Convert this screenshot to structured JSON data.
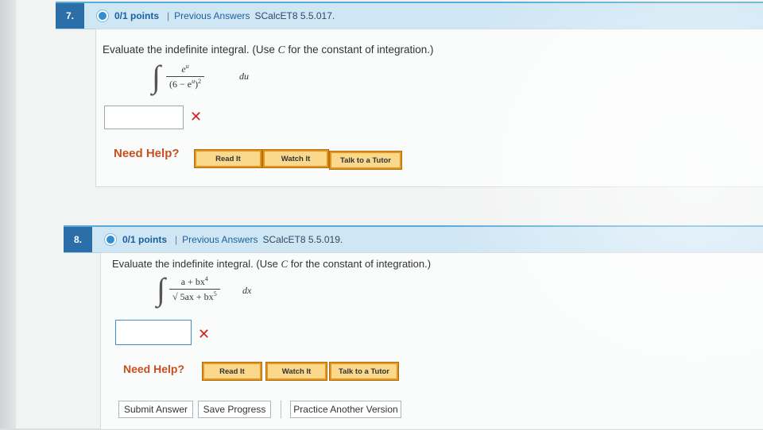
{
  "questions": [
    {
      "number": "7.",
      "points": "0/1 points",
      "separator": "|",
      "previous_answers": "Previous Answers",
      "code": "SCalcET8 5.5.017.",
      "prompt_before": "Evaluate the indefinite integral. (Use ",
      "prompt_var": "C",
      "prompt_after": " for the constant of integration.)",
      "integrand_numerator": "e",
      "integrand_numerator_sup": "u",
      "integrand_denominator": "(6 − e",
      "integrand_denominator_sup": "u",
      "integrand_denominator_tail": ")",
      "integrand_denominator_power": "2",
      "differential": "du",
      "answer_value": "",
      "result_mark": "✕",
      "help_label": "Need Help?",
      "help_buttons": [
        "Read It",
        "Watch It",
        "Talk to a Tutor"
      ]
    },
    {
      "number": "8.",
      "points": "0/1 points",
      "separator": "|",
      "previous_answers": "Previous Answers",
      "code": "SCalcET8 5.5.019.",
      "prompt_before": "Evaluate the indefinite integral. (Use ",
      "prompt_var": "C",
      "prompt_after": " for the constant of integration.)",
      "integrand_numerator": "a + bx",
      "integrand_numerator_sup": "4",
      "integrand_denominator": "√ 5ax + bx",
      "integrand_denominator_sup": "5",
      "differential": "dx",
      "answer_value": "",
      "result_mark": "✕",
      "help_label": "Need Help?",
      "help_buttons": [
        "Read It",
        "Watch It",
        "Talk to a Tutor"
      ]
    }
  ],
  "footer_buttons": {
    "submit": "Submit Answer",
    "save": "Save Progress",
    "practice": "Practice Another Version"
  },
  "colors": {
    "header_bar": "#cfe6f4",
    "number_badge": "#2b6ea8",
    "help_text": "#c5501e",
    "help_button": "#fbd98c",
    "error_mark": "#d62020"
  }
}
